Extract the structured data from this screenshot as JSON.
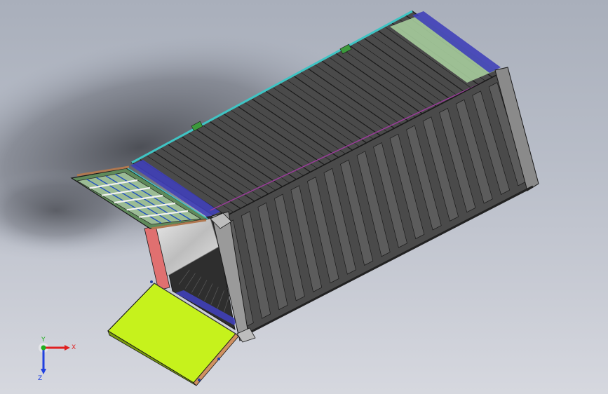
{
  "triad": {
    "x_label": "X",
    "y_label": "Y",
    "z_label": "Z",
    "colors": {
      "x": "#e02020",
      "y": "#20b020",
      "z": "#2040e0"
    }
  },
  "model": {
    "body_color": "#4a4a4a",
    "rib_color": "#5c5c5c",
    "edge_color": "#1a1a1a",
    "floor_color": "#3c3c3c",
    "door_panel_color": "#c6f21c",
    "highlight_colors": {
      "teal": "#3fc4c4",
      "blue": "#4040b8",
      "green": "#3c9a3c",
      "light_green": "#a6cc9c",
      "purple": "#9a3c9a",
      "red": "#e07070",
      "brown": "#b07850"
    }
  }
}
